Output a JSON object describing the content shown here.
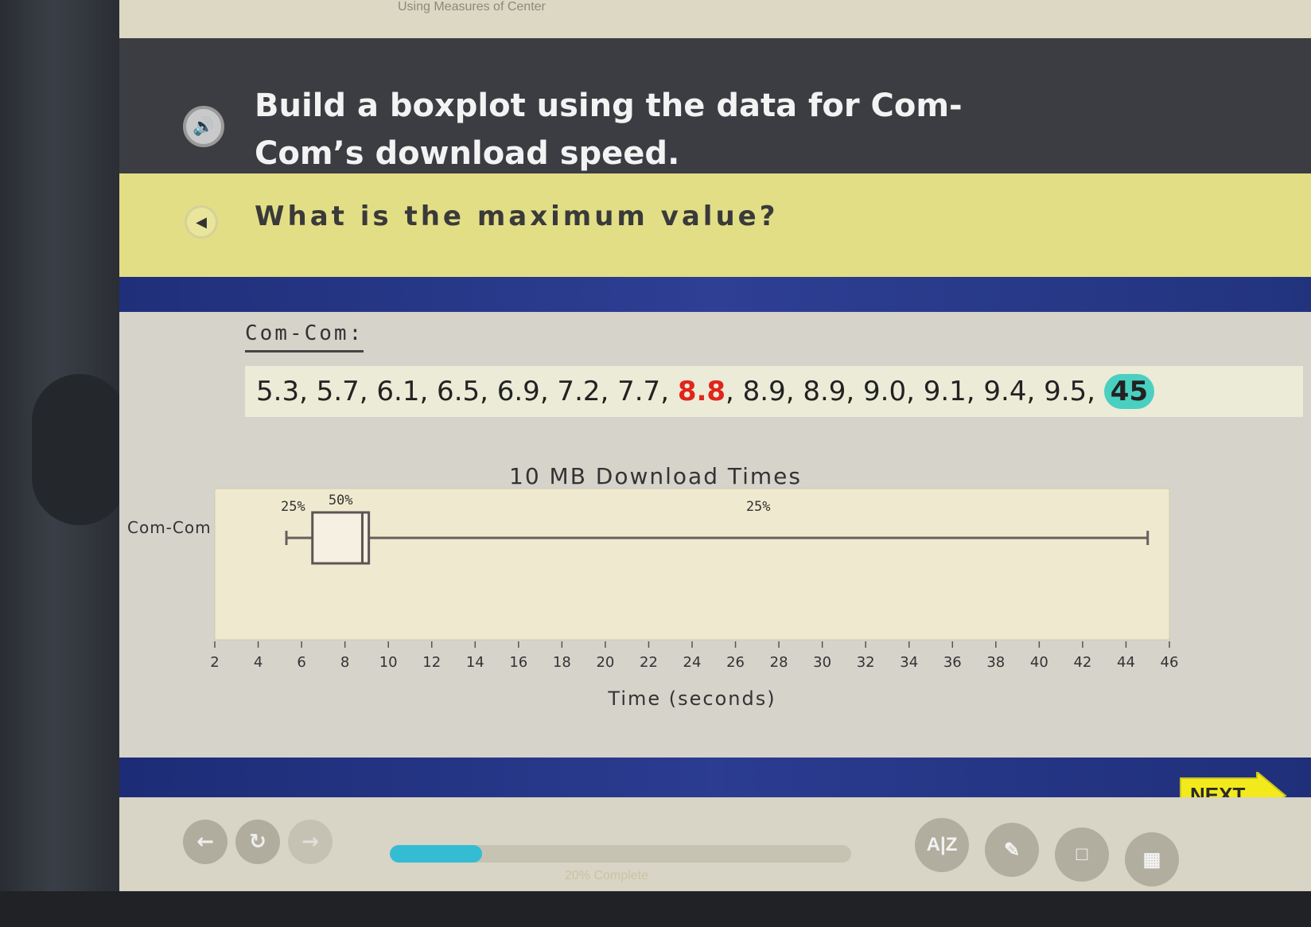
{
  "breadcrumb": "Using Measures of Center",
  "instruction": {
    "text": "Build a boxplot using the data for Com-Com’s download speed."
  },
  "question": {
    "text": "What is the maximum value?"
  },
  "dataset": {
    "label": "Com-Com:",
    "values_before": "5.3, 5.7, 6.1, 6.5, 6.9, 7.2, 7.7, ",
    "value_median": "8.8",
    "values_after": ", 8.9, 8.9, 9.0, 9.1, 9.4, 9.5, ",
    "value_max": "45"
  },
  "chart_data": {
    "type": "boxplot",
    "title": "10 MB Download Times",
    "xlabel": "Time (seconds)",
    "category": "Com-Com",
    "x_ticks": [
      2,
      4,
      6,
      8,
      10,
      12,
      14,
      16,
      18,
      20,
      22,
      24,
      26,
      28,
      30,
      32,
      34,
      36,
      38,
      40,
      42,
      44,
      46
    ],
    "xlim": [
      2,
      46
    ],
    "box": {
      "min": 5.3,
      "q1": 6.5,
      "median": 8.8,
      "q3": 9.1,
      "max": 45
    },
    "annotations": [
      {
        "text": "25%",
        "segment": "lower-whisker"
      },
      {
        "text": "50%",
        "segment": "box"
      },
      {
        "text": "25%",
        "segment": "upper-whisker"
      }
    ]
  },
  "navigation": {
    "next_label": "NEXT",
    "progress_percent": 20,
    "progress_label": "20% Complete"
  },
  "tools": {
    "glossary_label": "A|Z"
  },
  "colors": {
    "highlight_red": "#e0251b",
    "highlight_teal": "#49d0c0",
    "progress": "#34bcd2",
    "next_yellow": "#f3ea1e"
  }
}
